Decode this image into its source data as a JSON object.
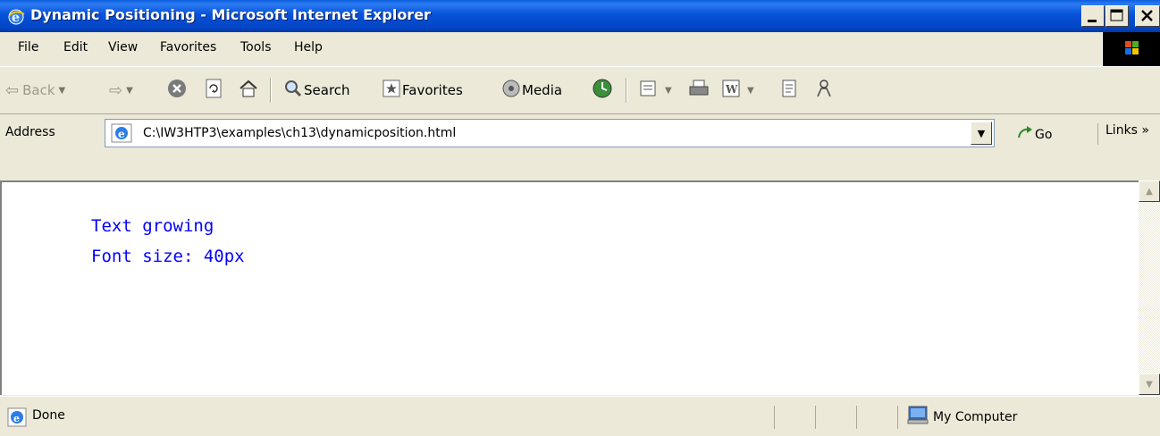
{
  "window": {
    "title": "Dynamic Positioning - Microsoft Internet Explorer"
  },
  "menu": [
    "File",
    "Edit",
    "View",
    "Favorites",
    "Tools",
    "Help"
  ],
  "toolbar": {
    "back": "Back",
    "search": "Search",
    "favorites": "Favorites",
    "media": "Media"
  },
  "address": {
    "label": "Address",
    "url": "C:\\IW3HTP3\\examples\\ch13\\dynamicposition.html",
    "go": "Go",
    "links": "Links »"
  },
  "page": {
    "line1": "Text growing",
    "line2": "Font size: 40px"
  },
  "status": {
    "text": "Done",
    "zone": "My Computer"
  },
  "colors": {
    "title_bar": "#0652D8",
    "page_text": "#0000FF",
    "chrome": "#ECE9D8"
  }
}
